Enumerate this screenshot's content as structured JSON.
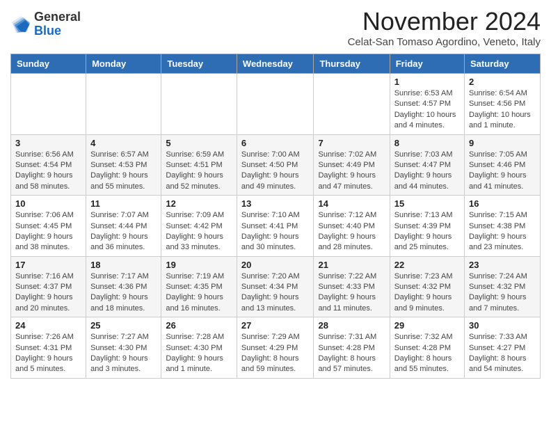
{
  "header": {
    "logo_general": "General",
    "logo_blue": "Blue",
    "month_title": "November 2024",
    "location": "Celat-San Tomaso Agordino, Veneto, Italy"
  },
  "days_of_week": [
    "Sunday",
    "Monday",
    "Tuesday",
    "Wednesday",
    "Thursday",
    "Friday",
    "Saturday"
  ],
  "weeks": [
    [
      {
        "day": "",
        "info": ""
      },
      {
        "day": "",
        "info": ""
      },
      {
        "day": "",
        "info": ""
      },
      {
        "day": "",
        "info": ""
      },
      {
        "day": "",
        "info": ""
      },
      {
        "day": "1",
        "info": "Sunrise: 6:53 AM\nSunset: 4:57 PM\nDaylight: 10 hours and 4 minutes."
      },
      {
        "day": "2",
        "info": "Sunrise: 6:54 AM\nSunset: 4:56 PM\nDaylight: 10 hours and 1 minute."
      }
    ],
    [
      {
        "day": "3",
        "info": "Sunrise: 6:56 AM\nSunset: 4:54 PM\nDaylight: 9 hours and 58 minutes."
      },
      {
        "day": "4",
        "info": "Sunrise: 6:57 AM\nSunset: 4:53 PM\nDaylight: 9 hours and 55 minutes."
      },
      {
        "day": "5",
        "info": "Sunrise: 6:59 AM\nSunset: 4:51 PM\nDaylight: 9 hours and 52 minutes."
      },
      {
        "day": "6",
        "info": "Sunrise: 7:00 AM\nSunset: 4:50 PM\nDaylight: 9 hours and 49 minutes."
      },
      {
        "day": "7",
        "info": "Sunrise: 7:02 AM\nSunset: 4:49 PM\nDaylight: 9 hours and 47 minutes."
      },
      {
        "day": "8",
        "info": "Sunrise: 7:03 AM\nSunset: 4:47 PM\nDaylight: 9 hours and 44 minutes."
      },
      {
        "day": "9",
        "info": "Sunrise: 7:05 AM\nSunset: 4:46 PM\nDaylight: 9 hours and 41 minutes."
      }
    ],
    [
      {
        "day": "10",
        "info": "Sunrise: 7:06 AM\nSunset: 4:45 PM\nDaylight: 9 hours and 38 minutes."
      },
      {
        "day": "11",
        "info": "Sunrise: 7:07 AM\nSunset: 4:44 PM\nDaylight: 9 hours and 36 minutes."
      },
      {
        "day": "12",
        "info": "Sunrise: 7:09 AM\nSunset: 4:42 PM\nDaylight: 9 hours and 33 minutes."
      },
      {
        "day": "13",
        "info": "Sunrise: 7:10 AM\nSunset: 4:41 PM\nDaylight: 9 hours and 30 minutes."
      },
      {
        "day": "14",
        "info": "Sunrise: 7:12 AM\nSunset: 4:40 PM\nDaylight: 9 hours and 28 minutes."
      },
      {
        "day": "15",
        "info": "Sunrise: 7:13 AM\nSunset: 4:39 PM\nDaylight: 9 hours and 25 minutes."
      },
      {
        "day": "16",
        "info": "Sunrise: 7:15 AM\nSunset: 4:38 PM\nDaylight: 9 hours and 23 minutes."
      }
    ],
    [
      {
        "day": "17",
        "info": "Sunrise: 7:16 AM\nSunset: 4:37 PM\nDaylight: 9 hours and 20 minutes."
      },
      {
        "day": "18",
        "info": "Sunrise: 7:17 AM\nSunset: 4:36 PM\nDaylight: 9 hours and 18 minutes."
      },
      {
        "day": "19",
        "info": "Sunrise: 7:19 AM\nSunset: 4:35 PM\nDaylight: 9 hours and 16 minutes."
      },
      {
        "day": "20",
        "info": "Sunrise: 7:20 AM\nSunset: 4:34 PM\nDaylight: 9 hours and 13 minutes."
      },
      {
        "day": "21",
        "info": "Sunrise: 7:22 AM\nSunset: 4:33 PM\nDaylight: 9 hours and 11 minutes."
      },
      {
        "day": "22",
        "info": "Sunrise: 7:23 AM\nSunset: 4:32 PM\nDaylight: 9 hours and 9 minutes."
      },
      {
        "day": "23",
        "info": "Sunrise: 7:24 AM\nSunset: 4:32 PM\nDaylight: 9 hours and 7 minutes."
      }
    ],
    [
      {
        "day": "24",
        "info": "Sunrise: 7:26 AM\nSunset: 4:31 PM\nDaylight: 9 hours and 5 minutes."
      },
      {
        "day": "25",
        "info": "Sunrise: 7:27 AM\nSunset: 4:30 PM\nDaylight: 9 hours and 3 minutes."
      },
      {
        "day": "26",
        "info": "Sunrise: 7:28 AM\nSunset: 4:30 PM\nDaylight: 9 hours and 1 minute."
      },
      {
        "day": "27",
        "info": "Sunrise: 7:29 AM\nSunset: 4:29 PM\nDaylight: 8 hours and 59 minutes."
      },
      {
        "day": "28",
        "info": "Sunrise: 7:31 AM\nSunset: 4:28 PM\nDaylight: 8 hours and 57 minutes."
      },
      {
        "day": "29",
        "info": "Sunrise: 7:32 AM\nSunset: 4:28 PM\nDaylight: 8 hours and 55 minutes."
      },
      {
        "day": "30",
        "info": "Sunrise: 7:33 AM\nSunset: 4:27 PM\nDaylight: 8 hours and 54 minutes."
      }
    ]
  ]
}
